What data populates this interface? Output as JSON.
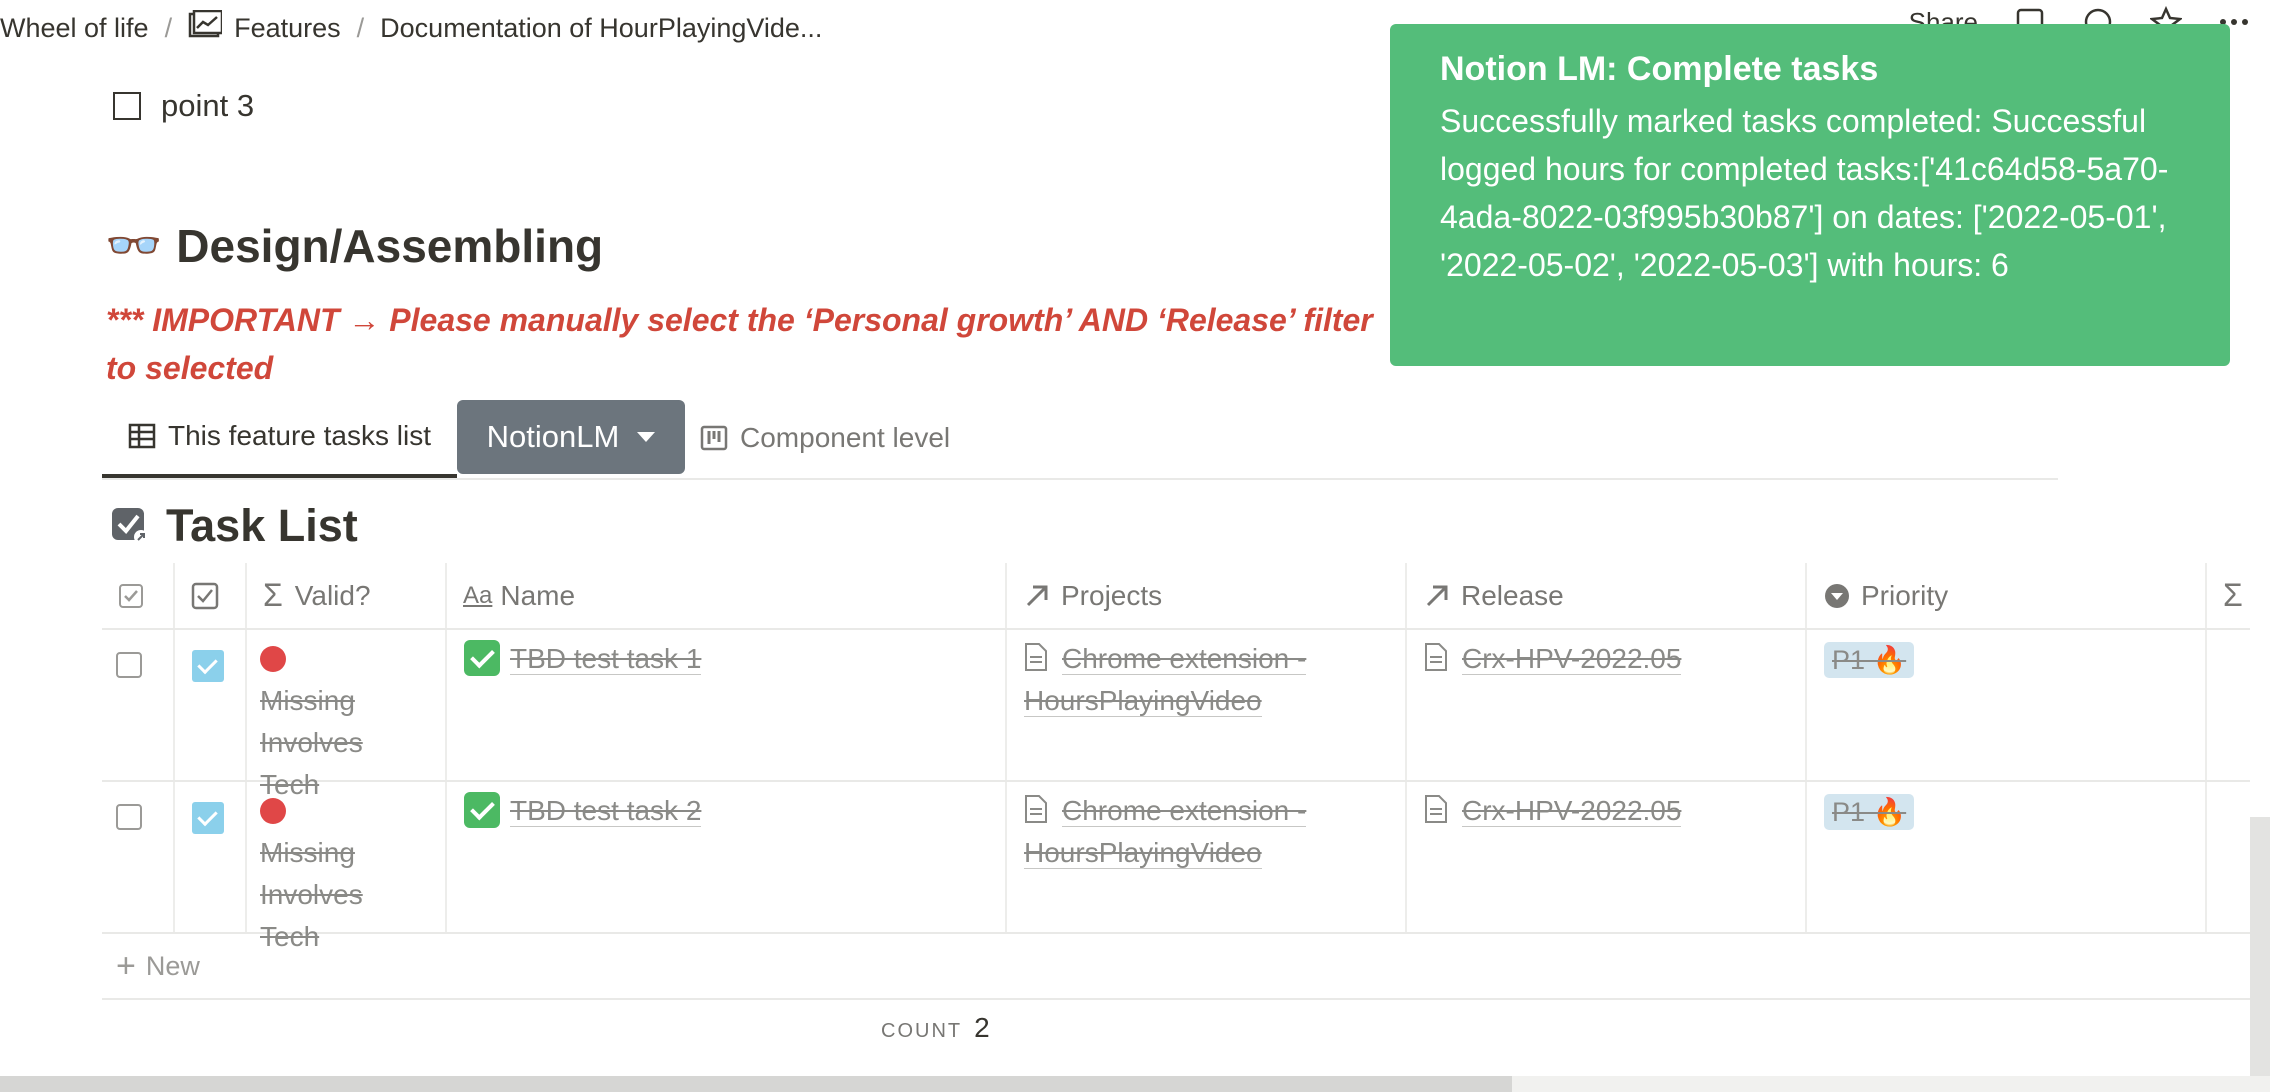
{
  "breadcrumb": {
    "items": [
      "Wheel of life",
      "Features",
      "Documentation of HourPlayingVide..."
    ],
    "separator": "/"
  },
  "topbar": {
    "share_label": "Share"
  },
  "todo": {
    "label": "point 3",
    "checked": false
  },
  "section": {
    "emoji": "👓",
    "title": "Design/Assembling",
    "important_note": "*** IMPORTANT → Please manually select the ‘Personal growth’ AND ‘Release’ filter to selected"
  },
  "tabs": {
    "active_label": "This feature tasks list",
    "dropdown_label": "NotionLM",
    "other_label": "Component level"
  },
  "database": {
    "title": "Task List",
    "columns": [
      "Valid?",
      "Name",
      "Projects",
      "Release",
      "Priority"
    ],
    "rows": [
      {
        "selected": false,
        "done": true,
        "valid": "Missing Involves Tech",
        "name": "TBD test task 1",
        "project": "Chrome extension - HoursPlayingVideo",
        "release": "Crx-HPV-2022.05",
        "priority": "P1 🔥"
      },
      {
        "selected": false,
        "done": true,
        "valid": "Missing Involves Tech",
        "name": "TBD test task 2",
        "project": "Chrome extension - HoursPlayingVideo",
        "release": "Crx-HPV-2022.05",
        "priority": "P1 🔥"
      }
    ],
    "new_label": "New",
    "count_label": "COUNT",
    "count_value": "2"
  },
  "toast": {
    "title": "Notion LM: Complete tasks",
    "body": "Successfully marked tasks completed: Successful logged hours for completed tasks:['41c64d58-5a70-4ada-8022-03f995b30b87'] on dates: ['2022-05-01', '2022-05-02', '2022-05-03'] with hours: 6",
    "color": "#54bd7a"
  },
  "colors": {
    "important": "#d0473a",
    "button": "#6c757d"
  }
}
